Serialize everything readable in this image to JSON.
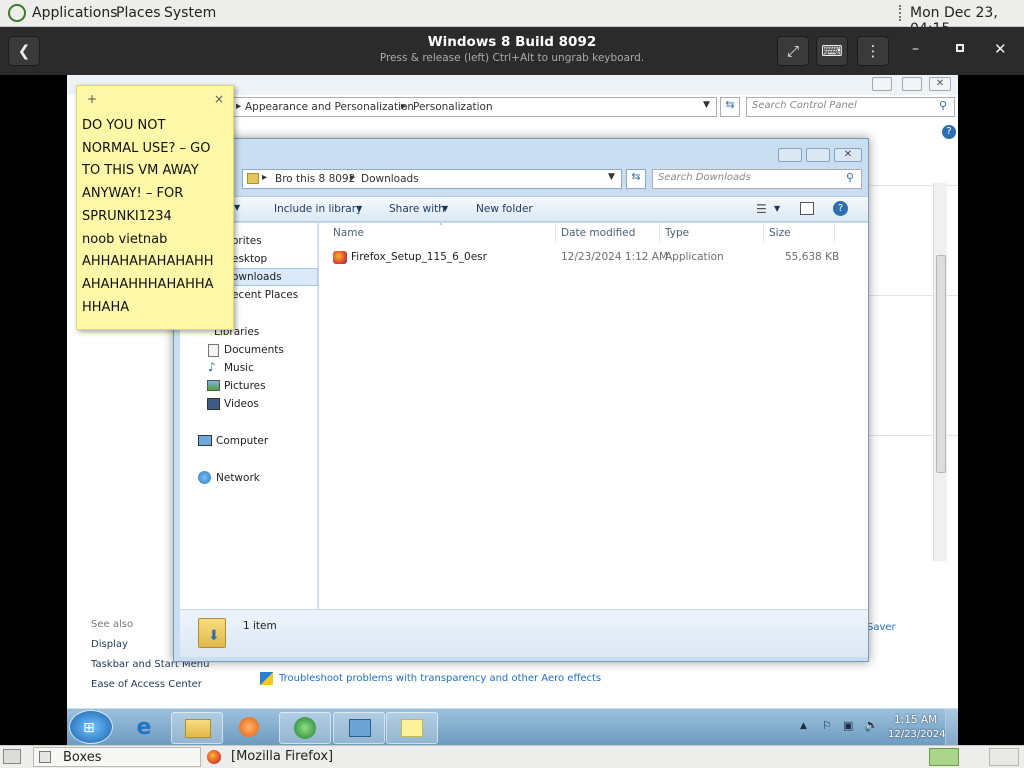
{
  "top_panel": {
    "applications": "Applications",
    "places": "Places",
    "system": "System",
    "clock": "Mon Dec 23, 04:15"
  },
  "boxes": {
    "title": "Windows 8 Build 8092",
    "subtitle": "Press & release (left) Ctrl+Alt to ungrab keyboard."
  },
  "control_panel": {
    "breadcrumb": [
      "Appearance and Personalization",
      "Personalization"
    ],
    "search_placeholder": "Search Control Panel",
    "see_also_title": "See also",
    "see_also": [
      "Display",
      "Taskbar and Start Menu",
      "Ease of Access Center"
    ],
    "link_troubleshoot": "Troubleshoot problems with transparency and other Aero effects",
    "saver_partial": "Saver"
  },
  "explorer": {
    "breadcrumb": [
      "Bro this 8 8092",
      "Downloads"
    ],
    "search_placeholder": "Search Downloads",
    "toolbar": {
      "organize_partial": "e",
      "include": "Include in library",
      "share": "Share with",
      "new_folder": "New folder"
    },
    "nav": {
      "favorites_partial": "orites",
      "desktop_partial": "esktop",
      "downloads_partial": "ownloads",
      "recent_partial": "ecent Places",
      "libraries_partial": "Libraries",
      "documents": "Documents",
      "music": "Music",
      "pictures": "Pictures",
      "videos": "Videos",
      "computer": "Computer",
      "network": "Network"
    },
    "columns": [
      "Name",
      "Date modified",
      "Type",
      "Size"
    ],
    "files": [
      {
        "name": "Firefox_Setup_115_6_0esr",
        "date": "12/23/2024 1:12 AM",
        "type": "Application",
        "size": "55,638 KB"
      }
    ],
    "status": "1 item"
  },
  "sticky": {
    "plus": "+",
    "close": "×",
    "lines": [
      "DO YOU NOT",
      "NORMAL USE? – GO",
      "TO THIS VM AWAY",
      "ANYWAY! – FOR",
      "SPRUNKI1234",
      "noob vietnab",
      "AHHAHAHAHAHAHH",
      "AHAHAHHHAHAHHA",
      "HHAHA"
    ]
  },
  "win_taskbar": {
    "time": "1:15 AM",
    "date": "12/23/2024"
  },
  "bottom_panel": {
    "boxes": "Boxes",
    "firefox": "[Mozilla Firefox]"
  }
}
